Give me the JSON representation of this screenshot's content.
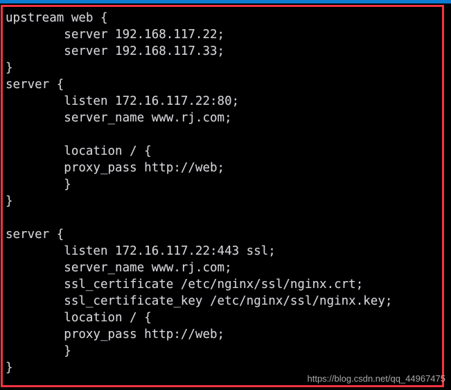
{
  "window": {
    "kind": "terminal-screenshot",
    "background_color": "#000000",
    "foreground_color": "#d6d6d6"
  },
  "top_accent_bar": {
    "color": "#0c7bd0"
  },
  "annotation": {
    "shape": "rectangle",
    "color": "#f5333f",
    "thickness_px": 3
  },
  "terminal": {
    "language": "nginx",
    "lines": [
      "upstream web {",
      "        server 192.168.117.22;",
      "        server 192.168.117.33;",
      "}",
      "server {",
      "        listen 172.16.117.22:80;",
      "        server_name www.rj.com;",
      "",
      "        location / {",
      "        proxy_pass http://web;",
      "        }",
      "}",
      "",
      "server {",
      "        listen 172.16.117.22:443 ssl;",
      "        server_name www.rj.com;",
      "        ssl_certificate /etc/nginx/ssl/nginx.crt;",
      "        ssl_certificate_key /etc/nginx/ssl/nginx.key;",
      "        location / {",
      "        proxy_pass http://web;",
      "        }",
      "}"
    ]
  },
  "watermark": {
    "text": "https://blog.csdn.net/qq_44967475"
  }
}
